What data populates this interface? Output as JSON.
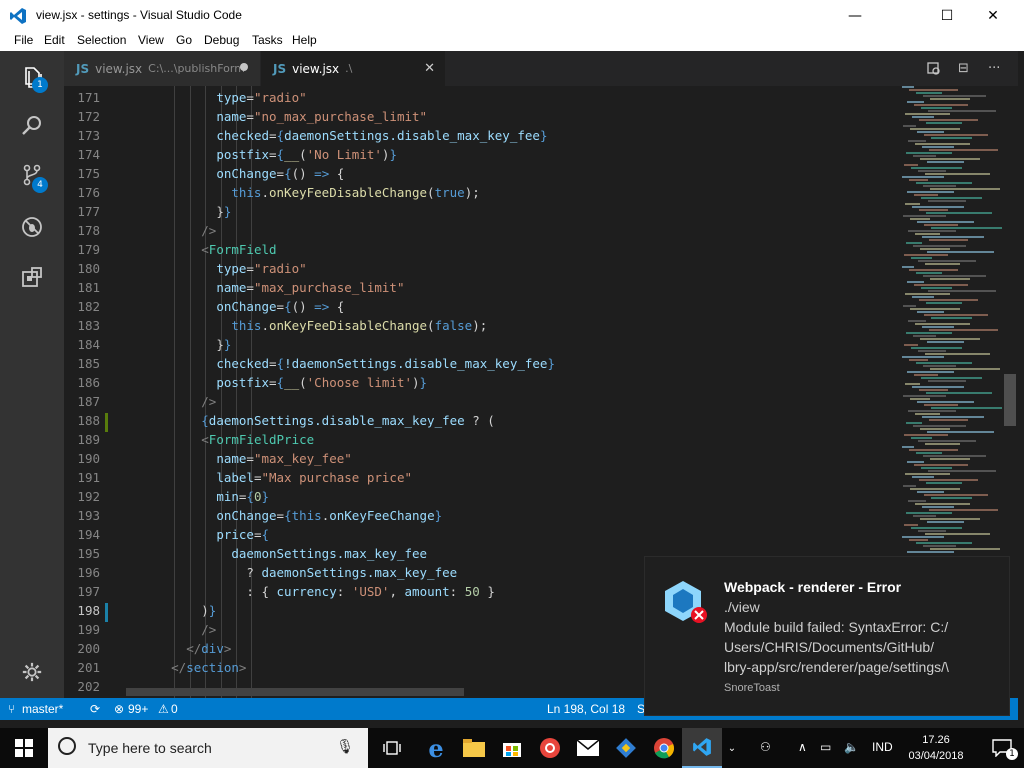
{
  "window": {
    "title": "view.jsx - settings - Visual Studio Code",
    "minimize": "—",
    "maximize": "☐",
    "close": "✕"
  },
  "menu": [
    "File",
    "Edit",
    "Selection",
    "View",
    "Go",
    "Debug",
    "Tasks",
    "Help"
  ],
  "activity": {
    "explorer_badge": "1",
    "scm_badge": "4"
  },
  "tabs": [
    {
      "name": "view.jsx",
      "path": "C:\\...\\publishForm",
      "icon": "JS",
      "state": "dirty"
    },
    {
      "name": "view.jsx",
      "path": ".\\",
      "icon": "JS",
      "state": "active"
    }
  ],
  "editor_actions": {
    "split": "⊟",
    "more": "···"
  },
  "lines": [
    {
      "n": "171",
      "t": [
        [
          "            ",
          "p"
        ],
        [
          "type",
          "a"
        ],
        [
          "=",
          "p"
        ],
        [
          "\"radio\"",
          "s"
        ]
      ]
    },
    {
      "n": "172",
      "t": [
        [
          "            ",
          "p"
        ],
        [
          "name",
          "a"
        ],
        [
          "=",
          "p"
        ],
        [
          "\"no_max_purchase_limit\"",
          "s"
        ]
      ]
    },
    {
      "n": "173",
      "t": [
        [
          "            ",
          "p"
        ],
        [
          "checked",
          "a"
        ],
        [
          "=",
          "p"
        ],
        [
          "{",
          "k"
        ],
        [
          "daemonSettings.disable_max_key_fee",
          "v"
        ],
        [
          "}",
          "k"
        ]
      ]
    },
    {
      "n": "174",
      "t": [
        [
          "            ",
          "p"
        ],
        [
          "postfix",
          "a"
        ],
        [
          "=",
          "p"
        ],
        [
          "{",
          "k"
        ],
        [
          "__",
          "f"
        ],
        [
          "(",
          "p"
        ],
        [
          "'No Limit'",
          "s"
        ],
        [
          ")",
          "p"
        ],
        [
          "}",
          "k"
        ]
      ]
    },
    {
      "n": "175",
      "t": [
        [
          "            ",
          "p"
        ],
        [
          "onChange",
          "a"
        ],
        [
          "=",
          "p"
        ],
        [
          "{",
          "k"
        ],
        [
          "() ",
          "p"
        ],
        [
          "=>",
          "k"
        ],
        [
          " {",
          "p"
        ]
      ]
    },
    {
      "n": "176",
      "t": [
        [
          "              ",
          "p"
        ],
        [
          "this",
          "k"
        ],
        [
          ".",
          "p"
        ],
        [
          "onKeyFeeDisableChange",
          "f"
        ],
        [
          "(",
          "p"
        ],
        [
          "true",
          "k"
        ],
        [
          ");",
          "p"
        ]
      ]
    },
    {
      "n": "177",
      "t": [
        [
          "            ",
          "p"
        ],
        [
          "}",
          "p"
        ],
        [
          "}",
          "k"
        ]
      ]
    },
    {
      "n": "178",
      "t": [
        [
          "          ",
          "p"
        ],
        [
          "/>",
          "b"
        ]
      ]
    },
    {
      "n": "179",
      "t": [
        [
          "          ",
          "p"
        ],
        [
          "<",
          "b"
        ],
        [
          "FormField",
          "g"
        ]
      ]
    },
    {
      "n": "180",
      "t": [
        [
          "            ",
          "p"
        ],
        [
          "type",
          "a"
        ],
        [
          "=",
          "p"
        ],
        [
          "\"radio\"",
          "s"
        ]
      ]
    },
    {
      "n": "181",
      "t": [
        [
          "            ",
          "p"
        ],
        [
          "name",
          "a"
        ],
        [
          "=",
          "p"
        ],
        [
          "\"max_purchase_limit\"",
          "s"
        ]
      ]
    },
    {
      "n": "182",
      "t": [
        [
          "            ",
          "p"
        ],
        [
          "onChange",
          "a"
        ],
        [
          "=",
          "p"
        ],
        [
          "{",
          "k"
        ],
        [
          "() ",
          "p"
        ],
        [
          "=>",
          "k"
        ],
        [
          " {",
          "p"
        ]
      ]
    },
    {
      "n": "183",
      "t": [
        [
          "              ",
          "p"
        ],
        [
          "this",
          "k"
        ],
        [
          ".",
          "p"
        ],
        [
          "onKeyFeeDisableChange",
          "f"
        ],
        [
          "(",
          "p"
        ],
        [
          "false",
          "k"
        ],
        [
          ");",
          "p"
        ]
      ]
    },
    {
      "n": "184",
      "t": [
        [
          "            ",
          "p"
        ],
        [
          "}",
          "p"
        ],
        [
          "}",
          "k"
        ]
      ]
    },
    {
      "n": "185",
      "t": [
        [
          "            ",
          "p"
        ],
        [
          "checked",
          "a"
        ],
        [
          "=",
          "p"
        ],
        [
          "{",
          "k"
        ],
        [
          "!daemonSettings.disable_max_key_fee",
          "v"
        ],
        [
          "}",
          "k"
        ]
      ]
    },
    {
      "n": "186",
      "t": [
        [
          "            ",
          "p"
        ],
        [
          "postfix",
          "a"
        ],
        [
          "=",
          "p"
        ],
        [
          "{",
          "k"
        ],
        [
          "__",
          "f"
        ],
        [
          "(",
          "p"
        ],
        [
          "'Choose limit'",
          "s"
        ],
        [
          ")",
          "p"
        ],
        [
          "}",
          "k"
        ]
      ]
    },
    {
      "n": "187",
      "t": [
        [
          "          ",
          "p"
        ],
        [
          "/>",
          "b"
        ]
      ]
    },
    {
      "n": "188",
      "t": [
        [
          "          ",
          "p"
        ],
        [
          "{",
          "k"
        ],
        [
          "daemonSettings.disable_max_key_fee",
          "v"
        ],
        [
          " ? (",
          "p"
        ]
      ]
    },
    {
      "n": "189",
      "t": [
        [
          "          ",
          "p"
        ],
        [
          "<",
          "b"
        ],
        [
          "FormFieldPrice",
          "g"
        ]
      ]
    },
    {
      "n": "190",
      "t": [
        [
          "            ",
          "p"
        ],
        [
          "name",
          "a"
        ],
        [
          "=",
          "p"
        ],
        [
          "\"max_key_fee\"",
          "s"
        ]
      ]
    },
    {
      "n": "191",
      "t": [
        [
          "            ",
          "p"
        ],
        [
          "label",
          "a"
        ],
        [
          "=",
          "p"
        ],
        [
          "\"Max purchase price\"",
          "s"
        ]
      ]
    },
    {
      "n": "192",
      "t": [
        [
          "            ",
          "p"
        ],
        [
          "min",
          "a"
        ],
        [
          "=",
          "p"
        ],
        [
          "{",
          "k"
        ],
        [
          "0",
          "n"
        ],
        [
          "}",
          "k"
        ]
      ]
    },
    {
      "n": "193",
      "t": [
        [
          "            ",
          "p"
        ],
        [
          "onChange",
          "a"
        ],
        [
          "=",
          "p"
        ],
        [
          "{",
          "k"
        ],
        [
          "this",
          "k"
        ],
        [
          ".",
          "p"
        ],
        [
          "onKeyFeeChange",
          "v"
        ],
        [
          "}",
          "k"
        ]
      ]
    },
    {
      "n": "194",
      "t": [
        [
          "            ",
          "p"
        ],
        [
          "price",
          "a"
        ],
        [
          "=",
          "p"
        ],
        [
          "{",
          "k"
        ]
      ]
    },
    {
      "n": "195",
      "t": [
        [
          "              ",
          "p"
        ],
        [
          "daemonSettings.max_key_fee",
          "v"
        ]
      ]
    },
    {
      "n": "196",
      "t": [
        [
          "                ",
          "p"
        ],
        [
          "? ",
          "p"
        ],
        [
          "daemonSettings.max_key_fee",
          "v"
        ]
      ]
    },
    {
      "n": "197",
      "t": [
        [
          "                ",
          "p"
        ],
        [
          ": { ",
          "p"
        ],
        [
          "currency",
          "v"
        ],
        [
          ": ",
          "p"
        ],
        [
          "'USD'",
          "s"
        ],
        [
          ", ",
          "p"
        ],
        [
          "amount",
          "v"
        ],
        [
          ": ",
          "p"
        ],
        [
          "50",
          "n"
        ],
        [
          " }",
          "p"
        ]
      ]
    },
    {
      "n": "198",
      "t": [
        [
          "          ",
          "p"
        ],
        [
          ")",
          "p"
        ],
        [
          "}",
          "k"
        ]
      ]
    },
    {
      "n": "199",
      "t": [
        [
          "          ",
          "p"
        ],
        [
          "/>",
          "b"
        ]
      ]
    },
    {
      "n": "200",
      "t": [
        [
          "        ",
          "p"
        ],
        [
          "</",
          "b"
        ],
        [
          "div",
          "k"
        ],
        [
          ">",
          "b"
        ]
      ]
    },
    {
      "n": "201",
      "t": [
        [
          "      ",
          "p"
        ],
        [
          "</",
          "b"
        ],
        [
          "section",
          "k"
        ],
        [
          ">",
          "b"
        ]
      ]
    },
    {
      "n": "202",
      "t": []
    }
  ],
  "status": {
    "branch": "master*",
    "sync": "⟳",
    "errors": "99+",
    "warnings": "0",
    "position": "Ln 198, Col 18",
    "spaces": "Sp"
  },
  "notification": {
    "title": "Webpack - renderer - Error",
    "lines": [
      "./view",
      "Module build failed: SyntaxError: C:/",
      "Users/CHRIS/Documents/GitHub/",
      "lbry-app/src/renderer/page/settings/\\"
    ],
    "source": "SnoreToast"
  },
  "taskbar": {
    "search_placeholder": "Type here to search",
    "language": "IND",
    "time": "17.26",
    "date": "03/04/2018",
    "notif_count": "1"
  },
  "colors": {
    "accent": "#007acc",
    "activity": "#333333",
    "editor_bg": "#1e1e1e"
  }
}
